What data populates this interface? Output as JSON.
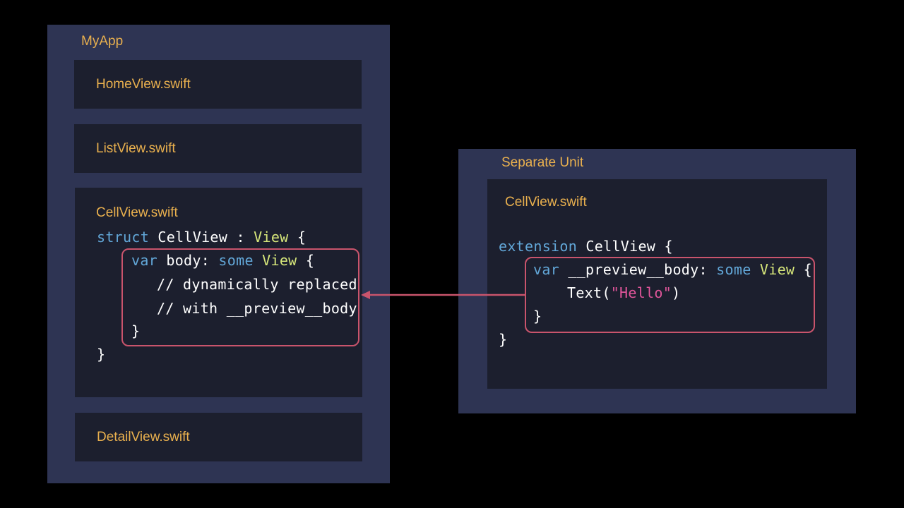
{
  "colors": {
    "background": "#000000",
    "panel": "#2e3453",
    "file_box": "#1c1f2e",
    "label": "#e9b04e",
    "keyword": "#62a7d8",
    "type": "#d6e67a",
    "string": "#e0559a",
    "highlight": "#c9546c"
  },
  "left": {
    "title": "MyApp",
    "files": {
      "home": "HomeView.swift",
      "list": "ListView.swift",
      "cell": "CellView.swift",
      "detail": "DetailView.swift"
    },
    "code": {
      "l1_kw": "struct",
      "l1_name": " CellView : ",
      "l1_type": "View",
      "l1_end": " {",
      "l2_kw1": "var",
      "l2_mid": " body: ",
      "l2_kw2": "some",
      "l2_sp": " ",
      "l2_type": "View",
      "l2_end": " {",
      "l3": "// dynamically replaced",
      "l4": "// with __preview__body",
      "l5": "}",
      "l6": "}"
    }
  },
  "right": {
    "title": "Separate Unit",
    "file": "CellView.swift",
    "code": {
      "l1_kw": "extension",
      "l1_rest": " CellView {",
      "l2_kw1": "var",
      "l2_mid": " __preview__body: ",
      "l2_kw2": "some",
      "l2_sp": " ",
      "l2_type": "View",
      "l2_end": " {",
      "l3_pre": "Text(",
      "l3_str": "\"Hello\"",
      "l3_post": ")",
      "l4": "}",
      "l5": "}"
    }
  }
}
